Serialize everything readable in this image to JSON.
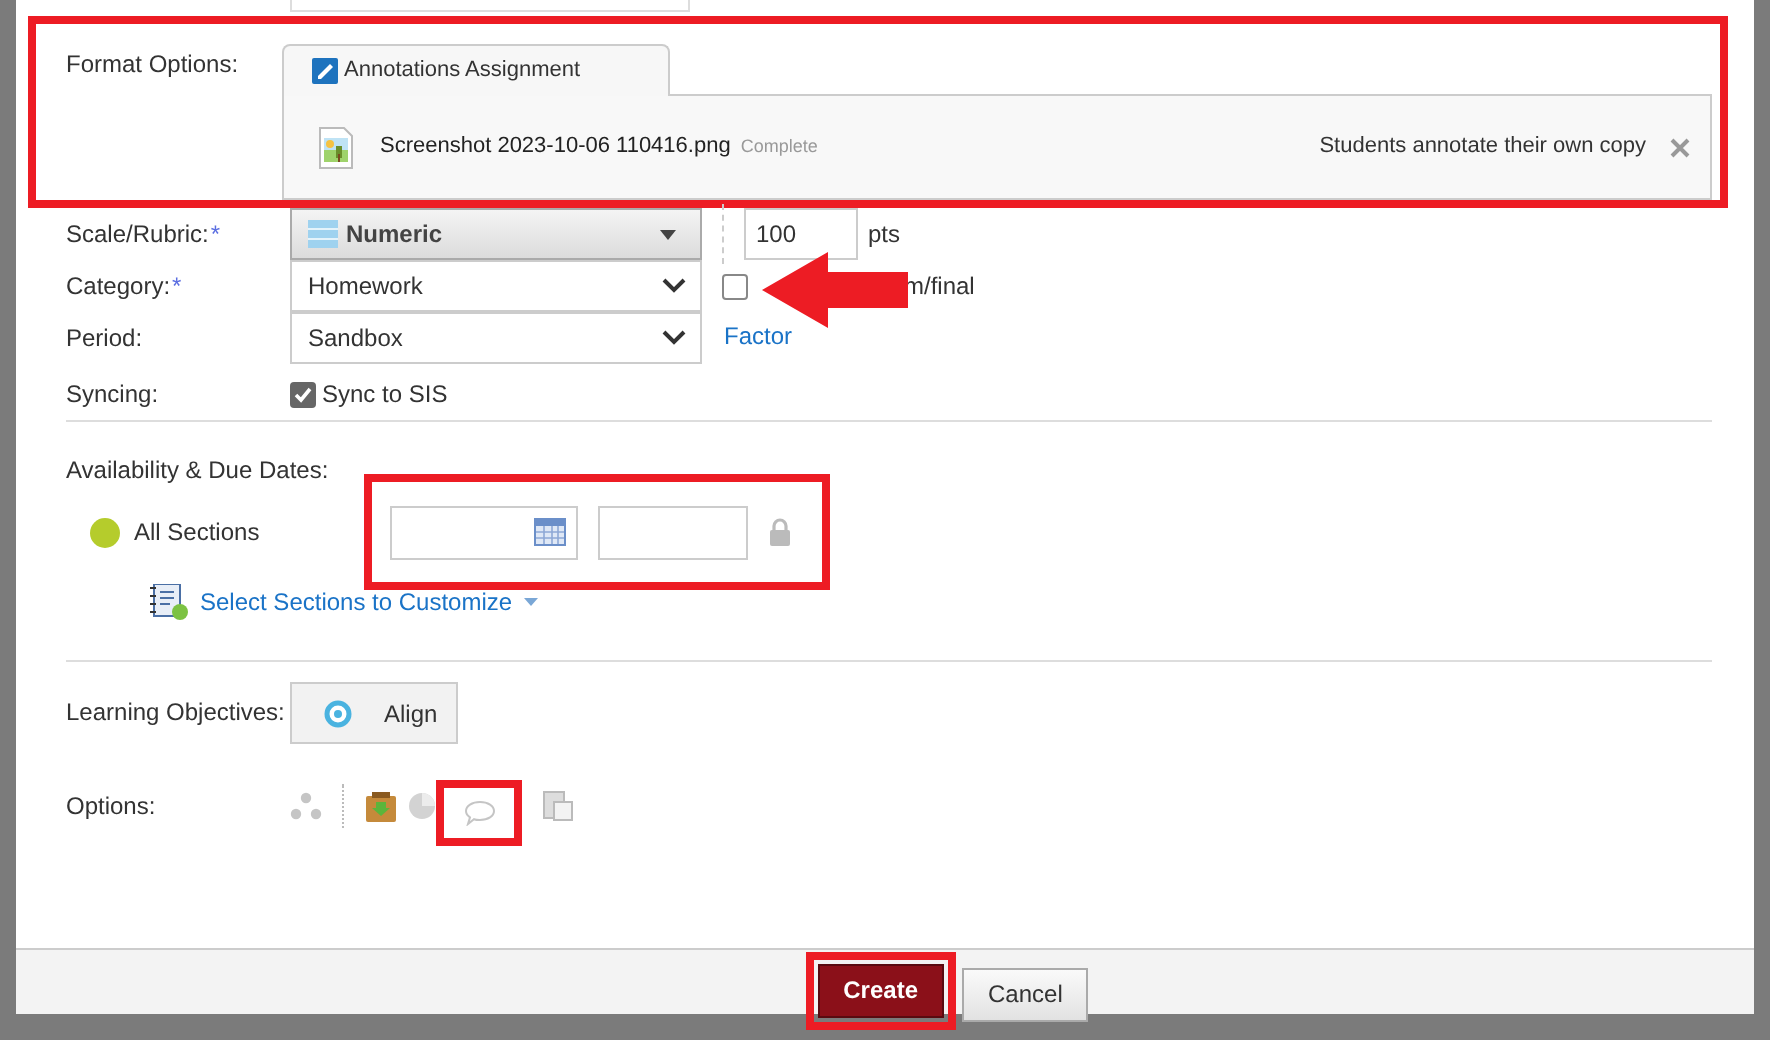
{
  "format_options": {
    "label": "Format Options:",
    "highlighted": true,
    "tab": "Annotations Assignment",
    "file": {
      "name": "Screenshot 2023-10-06 110416.png",
      "status": "Complete"
    },
    "mode": "Students annotate their own copy"
  },
  "scale": {
    "label": "Scale/Rubric:",
    "required": "*",
    "value": "Numeric",
    "points": "100",
    "unit": "pts"
  },
  "category": {
    "label": "Category:",
    "required": "*",
    "value": "Homework",
    "arrow": true,
    "checkbox": {
      "label": "m/final",
      "checked": false
    }
  },
  "period": {
    "label": "Period:",
    "value": "Sandbox",
    "link": "Factor"
  },
  "syncing": {
    "label": "Syncing:",
    "checkbox": {
      "label": "Sync to SIS",
      "checked": true
    }
  },
  "availability": {
    "label": "Availability & Due Dates:",
    "section": "All Sections",
    "dates_highlighted": true,
    "customize": "Select Sections to Customize"
  },
  "objectives": {
    "label": "Learning Objectives:",
    "button": "Align"
  },
  "options": {
    "label": "Options:",
    "icons": [
      {
        "kind": "share",
        "highlighted": false
      },
      {
        "kind": "download",
        "highlighted": false
      },
      {
        "kind": "chart",
        "highlighted": false
      },
      {
        "kind": "comment",
        "highlighted": true
      },
      {
        "kind": "copy",
        "highlighted": false
      }
    ]
  },
  "buttons": [
    {
      "label": "Create",
      "kind": "primary",
      "highlighted": true
    },
    {
      "label": "Cancel",
      "kind": "secondary",
      "highlighted": false
    }
  ]
}
